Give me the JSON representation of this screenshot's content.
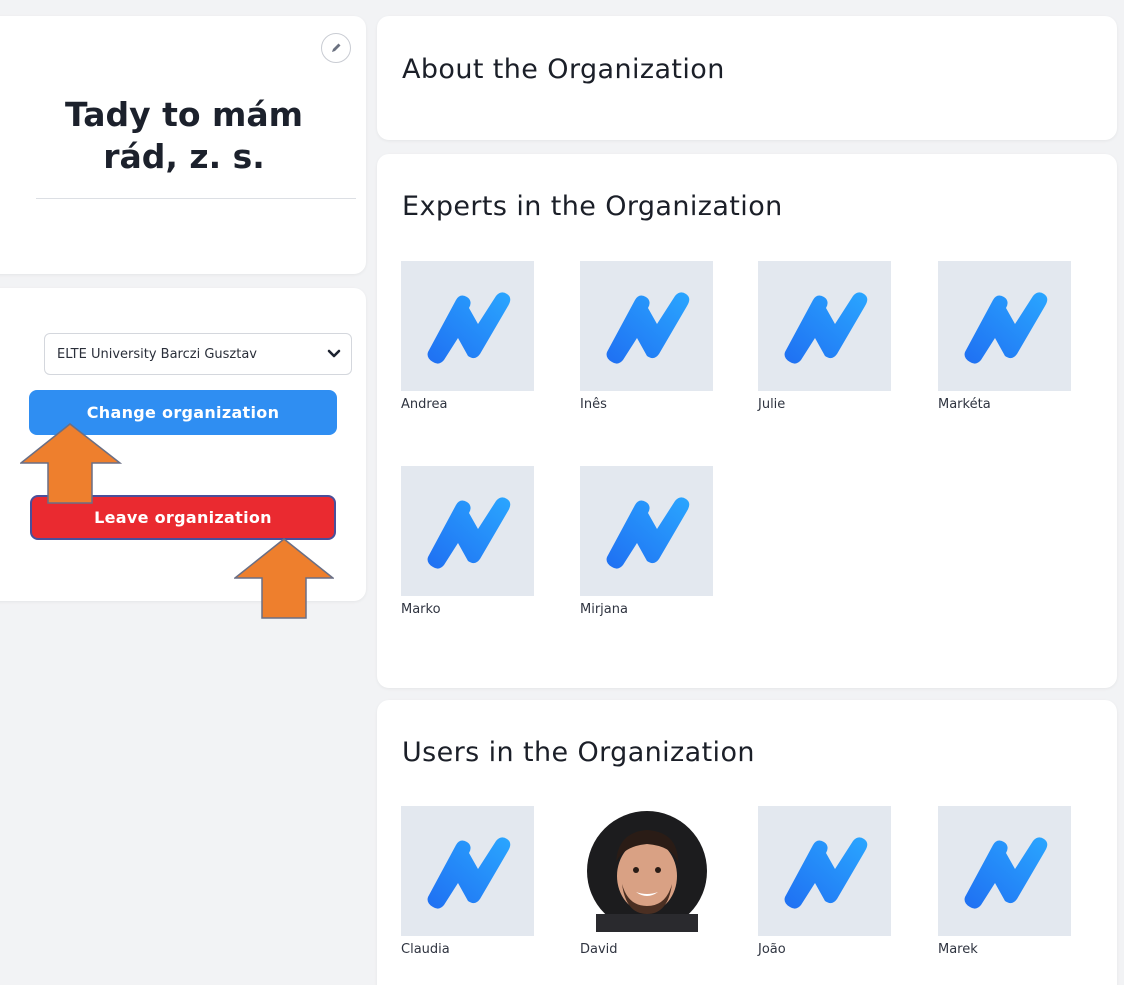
{
  "organization": {
    "name_line1": "Tady to mám",
    "name_line2": "rád, z. s."
  },
  "actions": {
    "select_value": "ELTE University Barczi Gusztav",
    "change_label": "Change organization",
    "leave_label": "Leave organization"
  },
  "about": {
    "title": "About the Organization"
  },
  "experts": {
    "title": "Experts in the Organization",
    "people": [
      "Andrea",
      "Inês",
      "Julie",
      "Markéta",
      "Marko",
      "Mirjana"
    ]
  },
  "users": {
    "title": "Users in the Organization",
    "people": [
      "Claudia",
      "David",
      "João",
      "Marek"
    ]
  },
  "colors": {
    "primary_blue": "#2f8ef2",
    "danger_red": "#ea2a30",
    "annotation_arrow": "#ee7f2d",
    "placeholder_bg": "#e3e8ef"
  },
  "icons": {
    "edit": "pencil-icon",
    "select_chevron": "chevron-down-icon",
    "placeholder": "logo-placeholder-icon"
  }
}
